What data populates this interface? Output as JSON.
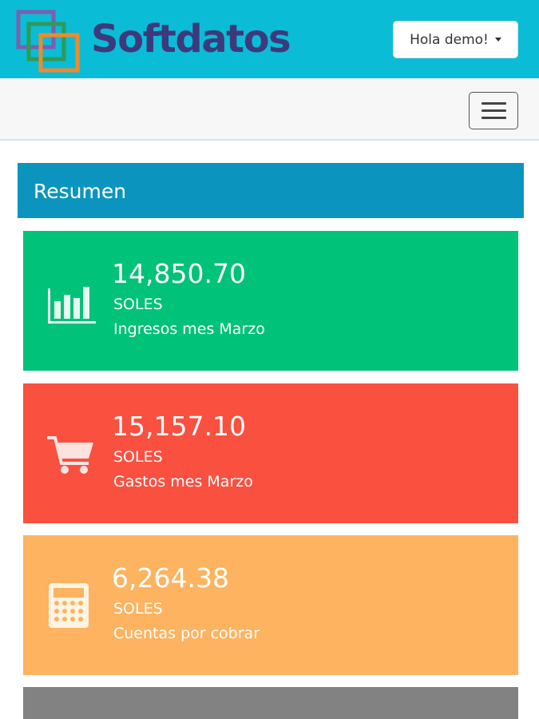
{
  "header": {
    "brand": "Softdatos",
    "user_menu_label": "Hola demo!",
    "colors": {
      "topbar": "#0bbcd6",
      "brand_text": "#3c3a7c"
    }
  },
  "navbar": {
    "menu_icon": "hamburger-icon"
  },
  "summary": {
    "title": "Resumen",
    "cards": [
      {
        "amount": "14,850.70",
        "currency": "SOLES",
        "caption": "Ingresos mes Marzo",
        "icon": "bar-chart-icon",
        "color": "#00c278"
      },
      {
        "amount": "15,157.10",
        "currency": "SOLES",
        "caption": "Gastos mes Marzo",
        "icon": "shopping-cart-icon",
        "color": "#f95040"
      },
      {
        "amount": "6,264.38",
        "currency": "SOLES",
        "caption": "Cuentas por cobrar",
        "icon": "calculator-icon",
        "color": "#fdb35f"
      },
      {
        "color": "#828282"
      }
    ]
  }
}
